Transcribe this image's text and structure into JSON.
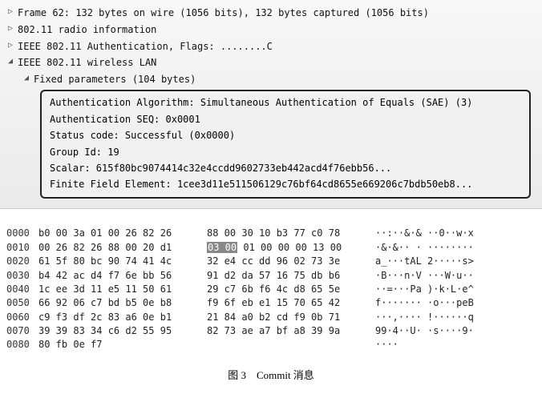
{
  "tree": {
    "frame": "Frame 62: 132 bytes on wire (1056 bits), 132 bytes captured (1056 bits)",
    "radio": "802.11 radio information",
    "auth": "IEEE 802.11 Authentication, Flags: ........C",
    "wlan": "IEEE 802.11 wireless LAN",
    "fixed": "Fixed parameters (104 bytes)"
  },
  "details": {
    "algo": "Authentication Algorithm: Simultaneous Authentication of Equals (SAE) (3)",
    "seq": "Authentication SEQ: 0x0001",
    "status": "Status code: Successful (0x0000)",
    "group": "Group Id: 19",
    "scalar": "Scalar: 615f80bc9074414c32e4ccdd9602733eb442acd4f76ebb56...",
    "ffe": "Finite Field Element: 1cee3d11e511506129c76bf64cd8655e669206c7bdb50eb8..."
  },
  "hex": {
    "rows": [
      {
        "offset": "0000",
        "b1": "b0 00 3a 01 00 26 82 26",
        "b2": "88 00 30 10 b3 77 c0 78",
        "ascii": "··:··&·& ··0··w·x"
      },
      {
        "offset": "0010",
        "b1": "00 26 82 26 88 00 20 d1",
        "b2hl": "03 00",
        "b2rest": " 01 00 00 00 13 00",
        "ascii": "·&·&·· · ········"
      },
      {
        "offset": "0020",
        "b1": "61 5f 80 bc 90 74 41 4c",
        "b2": "32 e4 cc dd 96 02 73 3e",
        "ascii": "a_···tAL 2·····s>"
      },
      {
        "offset": "0030",
        "b1": "b4 42 ac d4 f7 6e bb 56",
        "b2": "91 d2 da 57 16 75 db b6",
        "ascii": "·B···n·V ···W·u··"
      },
      {
        "offset": "0040",
        "b1": "1c ee 3d 11 e5 11 50 61",
        "b2": "29 c7 6b f6 4c d8 65 5e",
        "ascii": "··=···Pa )·k·L·e^"
      },
      {
        "offset": "0050",
        "b1": "66 92 06 c7 bd b5 0e b8",
        "b2": "f9 6f eb e1 15 70 65 42",
        "ascii": "f······· ·o···peB"
      },
      {
        "offset": "0060",
        "b1": "c9 f3 df 2c 83 a6 0e b1",
        "b2": "21 84 a0 b2 cd f9 0b 71",
        "ascii": "···,···· !······q"
      },
      {
        "offset": "0070",
        "b1": "39 39 83 34 c6 d2 55 95",
        "b2": "82 73 ae a7 bf a8 39 9a",
        "ascii": "99·4··U· ·s····9·"
      },
      {
        "offset": "0080",
        "b1": "80 fb 0e f7",
        "b2": "",
        "ascii": "····"
      }
    ]
  },
  "caption": "图 3　Commit 消息",
  "watermark": ""
}
